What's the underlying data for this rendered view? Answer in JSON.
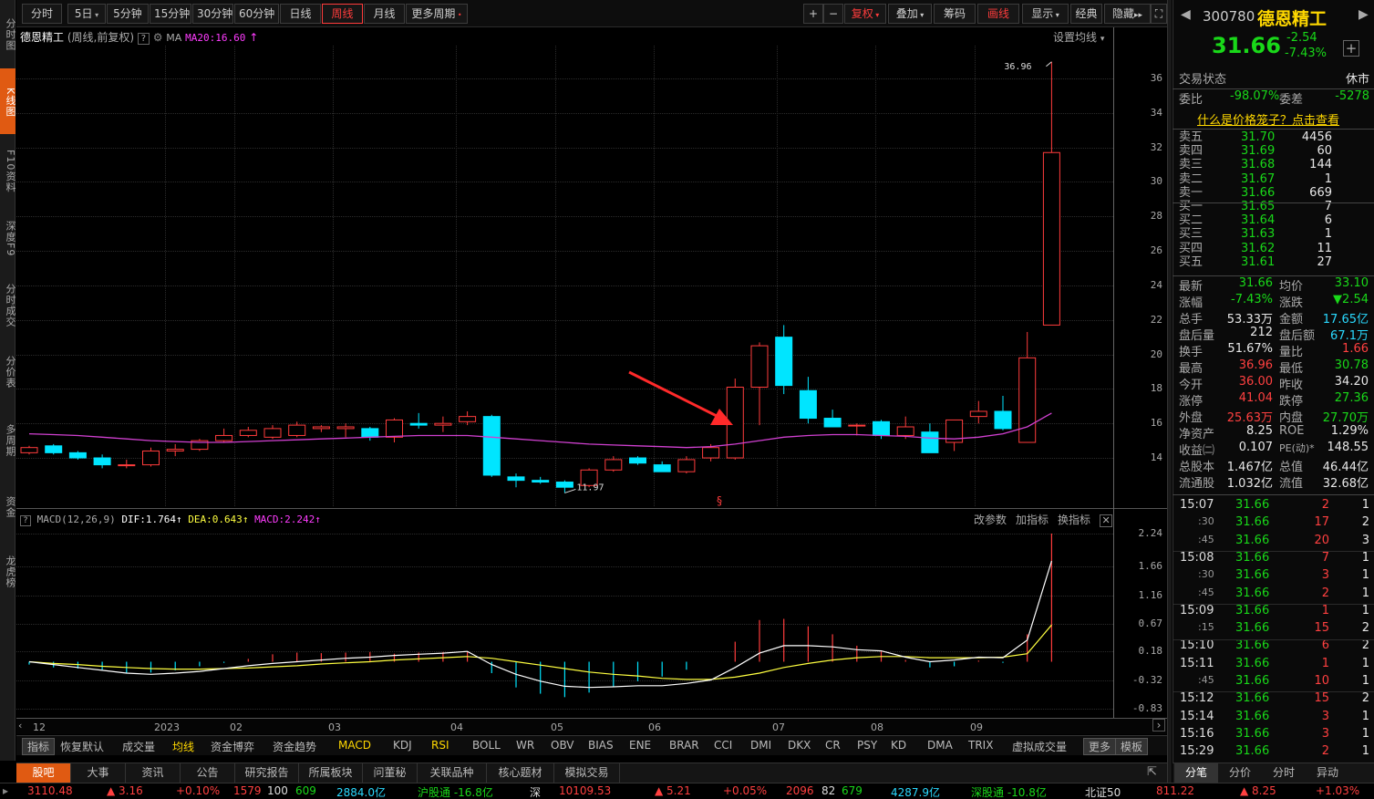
{
  "left_nav": [
    "分时图",
    "K线图",
    "F10资料",
    "深度F9",
    "分时成交",
    "分价表",
    "多周期",
    "资金",
    "龙虎榜"
  ],
  "toolbar": {
    "periods": [
      "分时",
      "5日",
      "5分钟",
      "15分钟",
      "30分钟",
      "60分钟",
      "日线",
      "周线",
      "月线",
      "更多周期"
    ],
    "active_period": "周线",
    "right_buttons": [
      "+",
      "−",
      "复权",
      "叠加",
      "筹码",
      "画线",
      "显示",
      "经典",
      "隐藏",
      "⛶"
    ]
  },
  "chart": {
    "title": "德恩精工",
    "subtitle": "(周线,前复权)",
    "ma_label": "MA",
    "ma20_label": "MA20:16.60",
    "settings_label": "设置均线",
    "max_label": "36.96",
    "min_label": "11.97",
    "marker": "§"
  },
  "colors": {
    "up": "#ff3c3c",
    "down": "#00e5ff",
    "ma20": "#d040d0",
    "dif": "#ffffff",
    "dea": "#ffff40",
    "accent": "#e05a12"
  },
  "chart_data": [
    {
      "type": "candlestick",
      "title": "德恩精工 (周线,前复权)",
      "y_ticks": [
        14.0,
        16.0,
        18.0,
        20.0,
        22.0,
        24.0,
        26.0,
        28.0,
        30.0,
        32.0,
        34.0,
        36.0
      ],
      "ylim": [
        11.2,
        37.9
      ],
      "x_labels": [
        "12",
        "2023",
        "02",
        "03",
        "04",
        "05",
        "06",
        "07",
        "08",
        "09"
      ],
      "candles": [
        {
          "o": 14.3,
          "h": 14.7,
          "l": 14.2,
          "c": 14.6
        },
        {
          "o": 14.7,
          "h": 14.8,
          "l": 14.2,
          "c": 14.3
        },
        {
          "o": 14.3,
          "h": 14.4,
          "l": 13.9,
          "c": 14.0
        },
        {
          "o": 14.0,
          "h": 14.2,
          "l": 13.4,
          "c": 13.6
        },
        {
          "o": 13.6,
          "h": 13.9,
          "l": 13.4,
          "c": 13.6
        },
        {
          "o": 13.6,
          "h": 14.6,
          "l": 13.5,
          "c": 14.4
        },
        {
          "o": 14.4,
          "h": 14.8,
          "l": 14.1,
          "c": 14.5
        },
        {
          "o": 14.5,
          "h": 15.1,
          "l": 14.4,
          "c": 15.0
        },
        {
          "o": 15.0,
          "h": 15.7,
          "l": 14.9,
          "c": 15.3
        },
        {
          "o": 15.3,
          "h": 15.8,
          "l": 15.2,
          "c": 15.6
        },
        {
          "o": 15.2,
          "h": 15.9,
          "l": 15.1,
          "c": 15.7
        },
        {
          "o": 15.3,
          "h": 16.1,
          "l": 15.2,
          "c": 15.9
        },
        {
          "o": 15.7,
          "h": 15.9,
          "l": 15.5,
          "c": 15.8
        },
        {
          "o": 15.7,
          "h": 16.0,
          "l": 15.2,
          "c": 15.8
        },
        {
          "o": 15.7,
          "h": 15.8,
          "l": 15.0,
          "c": 15.2
        },
        {
          "o": 15.2,
          "h": 16.3,
          "l": 14.9,
          "c": 16.2
        },
        {
          "o": 16.0,
          "h": 16.6,
          "l": 15.7,
          "c": 15.9
        },
        {
          "o": 15.9,
          "h": 16.4,
          "l": 15.5,
          "c": 16.0
        },
        {
          "o": 16.1,
          "h": 16.7,
          "l": 15.9,
          "c": 16.4
        },
        {
          "o": 16.4,
          "h": 16.5,
          "l": 12.9,
          "c": 13.0
        },
        {
          "o": 12.9,
          "h": 13.1,
          "l": 12.3,
          "c": 12.7
        },
        {
          "o": 12.7,
          "h": 12.9,
          "l": 12.5,
          "c": 12.6
        },
        {
          "o": 12.6,
          "h": 12.7,
          "l": 11.97,
          "c": 12.3
        },
        {
          "o": 12.4,
          "h": 13.4,
          "l": 12.3,
          "c": 13.3
        },
        {
          "o": 13.3,
          "h": 14.1,
          "l": 13.2,
          "c": 13.9
        },
        {
          "o": 14.0,
          "h": 14.1,
          "l": 13.6,
          "c": 13.7
        },
        {
          "o": 13.6,
          "h": 13.8,
          "l": 13.2,
          "c": 13.2
        },
        {
          "o": 13.2,
          "h": 14.1,
          "l": 13.1,
          "c": 13.9
        },
        {
          "o": 14.0,
          "h": 14.8,
          "l": 13.8,
          "c": 14.6
        },
        {
          "o": 14.0,
          "h": 18.6,
          "l": 13.9,
          "c": 18.1
        },
        {
          "o": 18.1,
          "h": 20.7,
          "l": 15.9,
          "c": 20.5
        },
        {
          "o": 21.0,
          "h": 21.7,
          "l": 17.7,
          "c": 18.2
        },
        {
          "o": 17.9,
          "h": 18.7,
          "l": 16.0,
          "c": 16.3
        },
        {
          "o": 16.3,
          "h": 16.8,
          "l": 15.8,
          "c": 15.8
        },
        {
          "o": 15.9,
          "h": 16.0,
          "l": 15.3,
          "c": 15.9
        },
        {
          "o": 16.1,
          "h": 16.2,
          "l": 15.1,
          "c": 15.3
        },
        {
          "o": 15.3,
          "h": 16.4,
          "l": 15.1,
          "c": 15.8
        },
        {
          "o": 15.5,
          "h": 16.0,
          "l": 14.3,
          "c": 14.3
        },
        {
          "o": 14.9,
          "h": 16.2,
          "l": 14.4,
          "c": 16.2
        },
        {
          "o": 16.4,
          "h": 17.3,
          "l": 16.0,
          "c": 16.7
        },
        {
          "o": 16.7,
          "h": 17.6,
          "l": 15.6,
          "c": 15.7
        },
        {
          "o": 14.9,
          "h": 21.3,
          "l": 14.9,
          "c": 19.8
        },
        {
          "o": 21.7,
          "h": 36.96,
          "l": 21.7,
          "c": 31.7
        }
      ],
      "ma20": [
        15.4,
        15.35,
        15.3,
        15.2,
        15.1,
        15.0,
        14.95,
        14.9,
        14.9,
        14.95,
        15.0,
        15.05,
        15.1,
        15.15,
        15.2,
        15.25,
        15.3,
        15.3,
        15.3,
        15.2,
        15.1,
        15.0,
        14.9,
        14.8,
        14.75,
        14.7,
        14.65,
        14.6,
        14.65,
        14.8,
        15.0,
        15.2,
        15.3,
        15.35,
        15.35,
        15.3,
        15.25,
        15.15,
        15.1,
        15.2,
        15.4,
        15.8,
        16.6
      ]
    },
    {
      "type": "macd",
      "title": "MACD(12,26,9)",
      "params": "MACD(12,26,9)",
      "dif_label": "DIF:1.764",
      "dea_label": "DEA:0.643",
      "macd_label": "MACD:2.242",
      "y_ticks": [
        2.24,
        1.66,
        1.16,
        0.67,
        0.18,
        -0.32,
        -0.83
      ],
      "ylim": [
        -0.95,
        2.45
      ],
      "dif": [
        0.0,
        -0.05,
        -0.1,
        -0.15,
        -0.2,
        -0.22,
        -0.2,
        -0.17,
        -0.12,
        -0.07,
        -0.03,
        0.0,
        0.03,
        0.06,
        0.08,
        0.11,
        0.13,
        0.15,
        0.18,
        -0.05,
        -0.22,
        -0.34,
        -0.43,
        -0.45,
        -0.44,
        -0.42,
        -0.42,
        -0.38,
        -0.32,
        -0.1,
        0.15,
        0.28,
        0.28,
        0.26,
        0.21,
        0.19,
        0.08,
        0.0,
        0.03,
        0.08,
        0.07,
        0.38,
        1.764
      ],
      "dea": [
        0.0,
        -0.03,
        -0.05,
        -0.08,
        -0.1,
        -0.12,
        -0.13,
        -0.13,
        -0.12,
        -0.11,
        -0.09,
        -0.07,
        -0.04,
        -0.02,
        0.0,
        0.03,
        0.05,
        0.07,
        0.09,
        0.06,
        0.0,
        -0.06,
        -0.12,
        -0.18,
        -0.22,
        -0.25,
        -0.29,
        -0.31,
        -0.31,
        -0.27,
        -0.2,
        -0.1,
        -0.03,
        0.03,
        0.07,
        0.09,
        0.09,
        0.07,
        0.07,
        0.07,
        0.08,
        0.14,
        0.643
      ],
      "macd": [
        -0.05,
        -0.1,
        -0.12,
        -0.14,
        -0.2,
        -0.19,
        -0.15,
        -0.08,
        -0.02,
        0.05,
        0.13,
        0.16,
        0.15,
        0.16,
        0.17,
        0.14,
        0.16,
        0.17,
        0.18,
        -0.2,
        -0.45,
        -0.56,
        -0.62,
        -0.54,
        -0.44,
        -0.34,
        -0.26,
        -0.14,
        0.0,
        0.35,
        0.73,
        0.75,
        0.62,
        0.48,
        0.28,
        0.2,
        0.03,
        -0.1,
        -0.08,
        0.02,
        -0.02,
        0.48,
        2.242
      ]
    }
  ],
  "macd_panel": {
    "buttons": [
      "改参数",
      "加指标",
      "换指标"
    ]
  },
  "indicator_tabs": [
    "指标",
    "恢复默认",
    "成交量",
    "均线",
    "资金博弈",
    "资金趋势",
    "MACD",
    "KDJ",
    "RSI",
    "BOLL",
    "WR",
    "OBV",
    "BIAS",
    "ENE",
    "BRAR",
    "CCI",
    "DMI",
    "DKX",
    "CR",
    "PSY",
    "KD",
    "DMA",
    "TRIX",
    "虚拟成交量",
    "更多",
    "模板"
  ],
  "bottom_nav": [
    "股吧",
    "大事",
    "资讯",
    "公告",
    "研究报告",
    "所属板块",
    "问董秘",
    "关联品种",
    "核心题材",
    "模拟交易"
  ],
  "status_bar": {
    "sh_index": "3110.48",
    "sh_change": "▲ 3.16",
    "sh_pct": "+0.10%",
    "sh_up": "1579",
    "sh_flat": "100",
    "sh_down": "609",
    "sh_amount": "2884.0亿",
    "hgt": "沪股通 -16.8亿",
    "sz_label": "深",
    "sz_index": "10109.53",
    "sz_change": "▲ 5.21",
    "sz_pct": "+0.05%",
    "sz_up": "2096",
    "sz_flat": "82",
    "sz_down": "679",
    "sz_amount": "4287.9亿",
    "sgt": "深股通 -10.8亿",
    "bz_label": "北证50",
    "bz_index": "811.22",
    "bz_change": "▲ 8.25",
    "bz_pct": "+1.03%"
  },
  "quote": {
    "code": "300780",
    "name": "德恩精工",
    "price": "31.66",
    "change": "-2.54",
    "pct": "-7.43%",
    "status_label": "交易状态",
    "status_value": "休市",
    "wb_label": "委比",
    "wb_value": "-98.07%",
    "wc_label": "委差",
    "wc_value": "-5278",
    "link": "什么是价格笼子？点击查看",
    "asks": [
      {
        "label": "卖五",
        "price": "31.70",
        "vol": "4456"
      },
      {
        "label": "卖四",
        "price": "31.69",
        "vol": "60"
      },
      {
        "label": "卖三",
        "price": "31.68",
        "vol": "144"
      },
      {
        "label": "卖二",
        "price": "31.67",
        "vol": "1"
      },
      {
        "label": "卖一",
        "price": "31.66",
        "vol": "669"
      }
    ],
    "bids": [
      {
        "label": "买一",
        "price": "31.65",
        "vol": "7"
      },
      {
        "label": "买二",
        "price": "31.64",
        "vol": "6"
      },
      {
        "label": "买三",
        "price": "31.63",
        "vol": "1"
      },
      {
        "label": "买四",
        "price": "31.62",
        "vol": "11"
      },
      {
        "label": "买五",
        "price": "31.61",
        "vol": "27"
      }
    ],
    "stats": [
      {
        "l1": "最新",
        "v1": "31.66",
        "c1": "dn",
        "l2": "均价",
        "v2": "33.10",
        "c2": "dn"
      },
      {
        "l1": "涨幅",
        "v1": "-7.43%",
        "c1": "dn",
        "l2": "涨跌",
        "v2": "▼2.54",
        "c2": "dn"
      },
      {
        "l1": "总手",
        "v1": "53.33万",
        "c1": "wt",
        "l2": "金额",
        "v2": "17.65亿",
        "c2": "cy"
      },
      {
        "l1": "盘后量",
        "v1": "212",
        "c1": "wt",
        "l2": "盘后额",
        "v2": "67.1万",
        "c2": "cy"
      },
      {
        "l1": "换手",
        "v1": "51.67%",
        "c1": "wt",
        "l2": "量比",
        "v2": "1.66",
        "c2": "up"
      },
      {
        "l1": "最高",
        "v1": "36.96",
        "c1": "up",
        "l2": "最低",
        "v2": "30.78",
        "c2": "dn"
      },
      {
        "l1": "今开",
        "v1": "36.00",
        "c1": "up",
        "l2": "昨收",
        "v2": "34.20",
        "c2": "wt"
      },
      {
        "l1": "涨停",
        "v1": "41.04",
        "c1": "up",
        "l2": "跌停",
        "v2": "27.36",
        "c2": "dn"
      },
      {
        "l1": "外盘",
        "v1": "25.63万",
        "c1": "up",
        "l2": "内盘",
        "v2": "27.70万",
        "c2": "dn"
      },
      {
        "l1": "净资产",
        "v1": "8.25",
        "c1": "wt",
        "l2": "ROE",
        "v2": "1.29%",
        "c2": "wt"
      },
      {
        "l1": "收益㈡",
        "v1": "0.107",
        "c1": "wt",
        "l2": "PE(动)*",
        "v2": "148.55",
        "c2": "wt"
      },
      {
        "l1": "总股本",
        "v1": "1.467亿",
        "c1": "wt",
        "l2": "总值",
        "v2": "46.44亿",
        "c2": "wt"
      },
      {
        "l1": "流通股",
        "v1": "1.032亿",
        "c1": "wt",
        "l2": "流值",
        "v2": "32.68亿",
        "c2": "wt"
      }
    ],
    "ticks": [
      {
        "t": "15:07",
        "p": "31.66",
        "v": "2",
        "c": "up",
        "n": "1"
      },
      {
        "t": ":30",
        "p": "31.66",
        "v": "17",
        "c": "up",
        "n": "2"
      },
      {
        "t": ":45",
        "p": "31.66",
        "v": "20",
        "c": "up",
        "n": "3"
      },
      {
        "t": "15:08",
        "p": "31.66",
        "v": "7",
        "c": "up",
        "n": "1"
      },
      {
        "t": ":30",
        "p": "31.66",
        "v": "3",
        "c": "up",
        "n": "1"
      },
      {
        "t": ":45",
        "p": "31.66",
        "v": "2",
        "c": "up",
        "n": "1"
      },
      {
        "t": "15:09",
        "p": "31.66",
        "v": "1",
        "c": "up",
        "n": "1"
      },
      {
        "t": ":15",
        "p": "31.66",
        "v": "15",
        "c": "up",
        "n": "2"
      },
      {
        "t": "15:10",
        "p": "31.66",
        "v": "6",
        "c": "up",
        "n": "2"
      },
      {
        "t": "15:11",
        "p": "31.66",
        "v": "1",
        "c": "up",
        "n": "1"
      },
      {
        "t": ":45",
        "p": "31.66",
        "v": "10",
        "c": "up",
        "n": "1"
      },
      {
        "t": "15:12",
        "p": "31.66",
        "v": "15",
        "c": "up",
        "n": "2"
      },
      {
        "t": "15:14",
        "p": "31.66",
        "v": "3",
        "c": "up",
        "n": "1"
      },
      {
        "t": "15:16",
        "p": "31.66",
        "v": "3",
        "c": "up",
        "n": "1"
      },
      {
        "t": "15:29",
        "p": "31.66",
        "v": "2",
        "c": "up",
        "n": "1"
      }
    ],
    "tabs": [
      "分笔",
      "分价",
      "分时",
      "异动"
    ]
  }
}
